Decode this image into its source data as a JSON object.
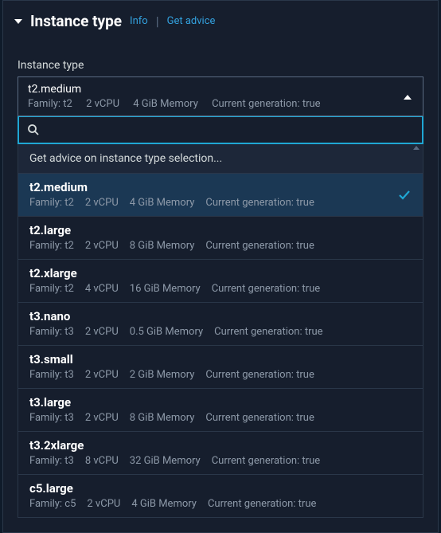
{
  "header": {
    "title": "Instance type",
    "info_link": "Info",
    "advice_link": "Get advice"
  },
  "field": {
    "label": "Instance type"
  },
  "selected": {
    "name": "t2.medium",
    "family": "Family: t2",
    "vcpu": "2 vCPU",
    "memory": "4 GiB Memory",
    "generation": "Current generation: true"
  },
  "search": {
    "value": ""
  },
  "advice_row": "Get advice on instance type selection...",
  "options": [
    {
      "name": "t2.medium",
      "family": "Family: t2",
      "vcpu": "2 vCPU",
      "memory": "4 GiB Memory",
      "generation": "Current generation: true",
      "selected": true
    },
    {
      "name": "t2.large",
      "family": "Family: t2",
      "vcpu": "2 vCPU",
      "memory": "8 GiB Memory",
      "generation": "Current generation: true",
      "selected": false
    },
    {
      "name": "t2.xlarge",
      "family": "Family: t2",
      "vcpu": "4 vCPU",
      "memory": "16 GiB Memory",
      "generation": "Current generation: true",
      "selected": false
    },
    {
      "name": "t3.nano",
      "family": "Family: t3",
      "vcpu": "2 vCPU",
      "memory": "0.5 GiB Memory",
      "generation": "Current generation: true",
      "selected": false
    },
    {
      "name": "t3.small",
      "family": "Family: t3",
      "vcpu": "2 vCPU",
      "memory": "2 GiB Memory",
      "generation": "Current generation: true",
      "selected": false
    },
    {
      "name": "t3.large",
      "family": "Family: t3",
      "vcpu": "2 vCPU",
      "memory": "8 GiB Memory",
      "generation": "Current generation: true",
      "selected": false
    },
    {
      "name": "t3.2xlarge",
      "family": "Family: t3",
      "vcpu": "8 vCPU",
      "memory": "32 GiB Memory",
      "generation": "Current generation: true",
      "selected": false
    },
    {
      "name": "c5.large",
      "family": "Family: c5",
      "vcpu": "2 vCPU",
      "memory": "4 GiB Memory",
      "generation": "Current generation: true",
      "selected": false
    }
  ]
}
